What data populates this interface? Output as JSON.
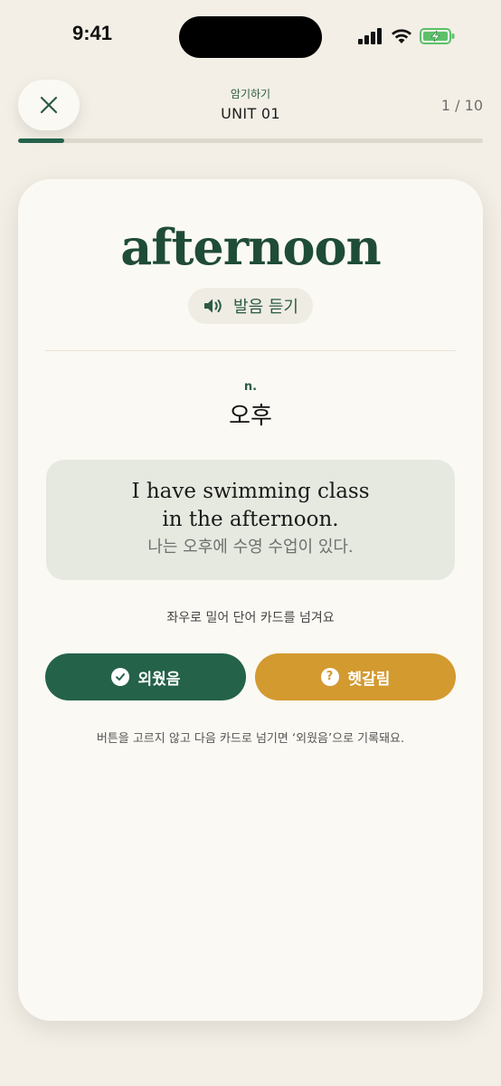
{
  "status_bar": {
    "time": "9:41",
    "icons": [
      "signal-icon",
      "wifi-icon",
      "battery-charging-icon"
    ]
  },
  "header": {
    "subtitle": "암기하기",
    "title": "UNIT 01",
    "progress_text": "1 / 10",
    "progress_fraction": 0.1,
    "close_icon": "close-icon"
  },
  "card": {
    "word": "afternoon",
    "listen_label": "발음 듣기",
    "listen_icon": "speaker-icon",
    "part_of_speech": "n.",
    "meaning": "오후",
    "example_en": "I have swimming class in the afternoon.",
    "example_ko": "나는 오후에 수영 수업이 있다.",
    "swipe_hint": "좌우로 밀어 단어 카드를 넘겨요",
    "buttons": {
      "known_label": "외웠음",
      "known_icon": "check-circle-icon",
      "unsure_label": "헷갈림",
      "unsure_icon": "question-circle-icon"
    },
    "bottom_note": "버튼을 고르지 않고 다음 카드로 넘기면 ‘외웠음’으로 기록돼요."
  },
  "colors": {
    "primary_green": "#24624a",
    "accent_yellow": "#d39a30",
    "background": "#f3efe6",
    "card": "#fbf9f3"
  }
}
